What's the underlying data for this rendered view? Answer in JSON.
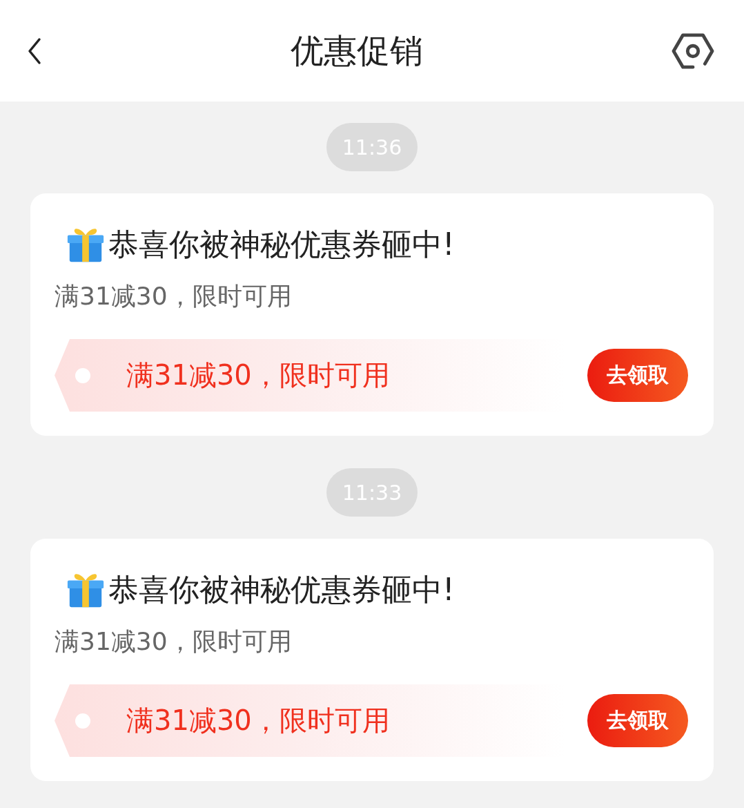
{
  "header": {
    "title": "优惠促销"
  },
  "messages": [
    {
      "time": "11:36",
      "title": "恭喜你被神秘优惠券砸中!",
      "subtitle": "满31减30，限时可用",
      "coupon": "满31减30，限时可用",
      "button": "去领取"
    },
    {
      "time": "11:33",
      "title": "恭喜你被神秘优惠券砸中!",
      "subtitle": "满31减30，限时可用",
      "coupon": "满31减30，限时可用",
      "button": "去领取"
    }
  ]
}
